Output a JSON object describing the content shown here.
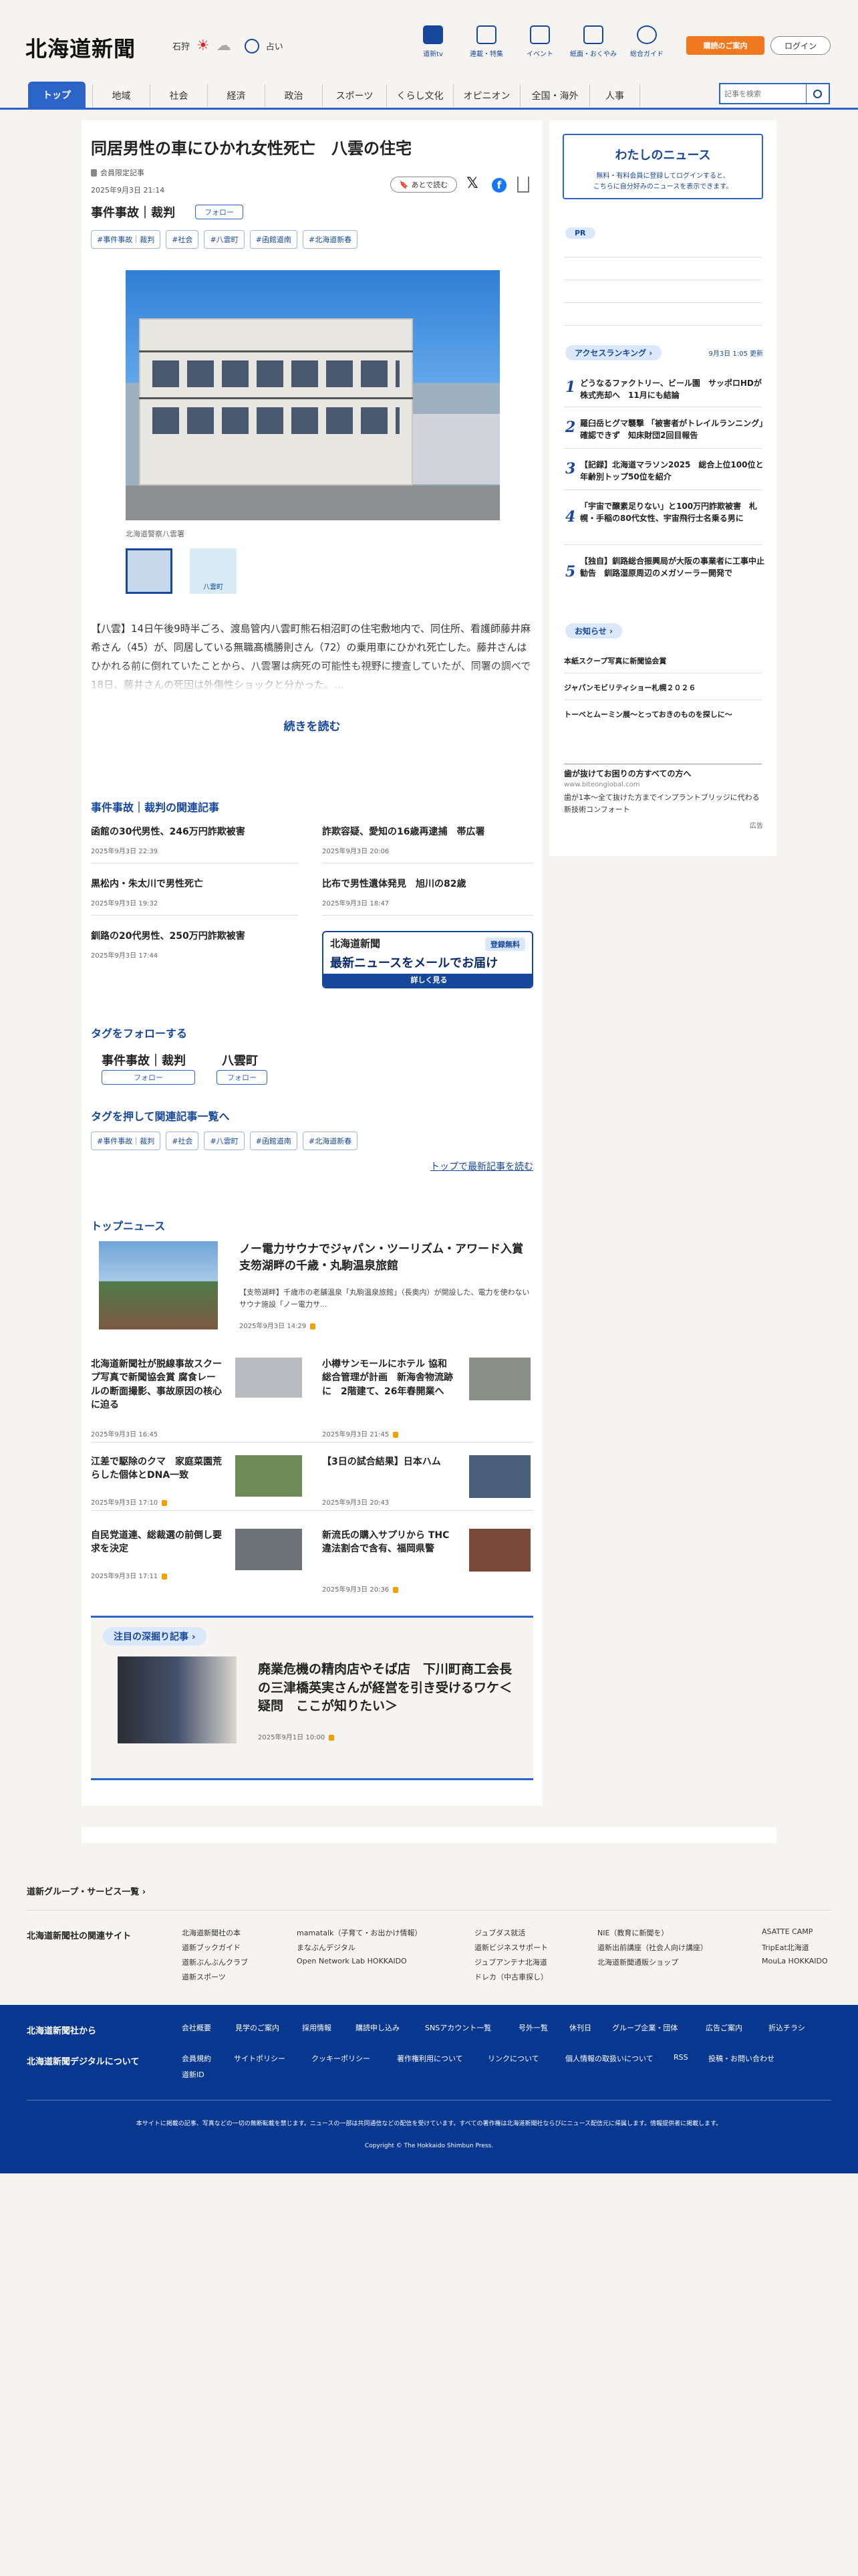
{
  "header": {
    "logo": "北海道新聞",
    "weather_region": "石狩",
    "fortune": "占い",
    "icons": [
      {
        "label": "道新tv",
        "icon": "tv-icon"
      },
      {
        "label": "連載・特集",
        "icon": "flag-icon"
      },
      {
        "label": "イベント",
        "icon": "calendar-icon"
      },
      {
        "label": "紙面・おくやみ",
        "icon": "newspaper-icon"
      },
      {
        "label": "総合ガイド",
        "icon": "help-icon"
      }
    ],
    "subscribe": "購読のご案内",
    "login": "ログイン"
  },
  "nav": {
    "items": [
      "トップ",
      "地域",
      "社会",
      "経済",
      "政治",
      "スポーツ",
      "くらし文化",
      "オピニオン",
      "全国・海外",
      "人事"
    ],
    "search_placeholder": "記事を検索"
  },
  "article": {
    "title": "同居男性の車にひかれ女性死亡　八雲の住宅",
    "badge": "会員限定記事",
    "date": "2025年9月3日 21:14",
    "save": "あとで読む",
    "category": "事件事故｜裁判",
    "follow": "フォロー",
    "tags": [
      "#事件事故｜裁判",
      "#社会",
      "#八雲町",
      "#函館道南",
      "#北海道新春"
    ],
    "caption": "北海道警察八雲署",
    "thumb2_label": "八雲町",
    "body": "【八雲】14日午後9時半ごろ、渡島管内八雲町熊石相沼町の住宅敷地内で、同住所、看護師藤井麻希さん（45）が、同居している無職髙橋勝則さん（72）の乗用車にひかれ死亡した。藤井さんはひかれる前に倒れていたことから、八雲署は病死の可能性も視野に捜査していたが、同署の調べで18日、藤井さんの死因は外傷性ショックと分かった。...",
    "read_more": "続きを読む"
  },
  "related": {
    "heading": "事件事故｜裁判の関連記事",
    "items": [
      {
        "title": "函館の30代男性、246万円詐欺被害",
        "date": "2025年9月3日 22:39"
      },
      {
        "title": "詐欺容疑、愛知の16歳再逮捕　帯広署",
        "date": "2025年9月3日 20:06"
      },
      {
        "title": "黒松内・朱太川で男性死亡",
        "date": "2025年9月3日 19:32"
      },
      {
        "title": "比布で男性遺体発見　旭川の82歳",
        "date": "2025年9月3日 18:47"
      },
      {
        "title": "釧路の20代男性、250万円詐欺被害",
        "date": "2025年9月3日 17:44"
      }
    ],
    "promo": {
      "logo": "北海道新聞",
      "tag": "登録無料",
      "main": "最新ニュースをメールでお届け",
      "cta": "詳しく見る"
    }
  },
  "follow_tags": {
    "heading": "タグをフォローする",
    "items": [
      "事件事故｜裁判",
      "八雲町"
    ],
    "follow": "フォロー"
  },
  "tag_list": {
    "heading": "タグを押して関連記事一覧へ",
    "latest_link": "トップで最新記事を読む"
  },
  "top_news": {
    "heading": "トップニュース",
    "lead": {
      "title": "ノー電力サウナでジャパン・ツーリズム・アワード入賞　支笏湖畔の千歳・丸駒温泉旅館",
      "summary": "【支笏湖畔】千歳市の老舗温泉「丸駒温泉旅館」（長奥内）が開設した、電力を使わないサウナ施設「ノー電力サ...",
      "date": "2025年9月3日 14:29"
    },
    "items": [
      {
        "title": "北海道新聞社が脱線事故スクープ写真で新聞協会賞 腐食レールの断面撮影、事故原因の核心に迫る",
        "date": "2025年9月3日 16:45"
      },
      {
        "title": "小樽サンモールにホテル 協和総合管理が計画　新海舎物流跡に　2階建て、26年春開業へ",
        "date": "2025年9月3日 21:45"
      },
      {
        "title": "江差で駆除のクマ　家庭菜園荒らした個体とDNA一致",
        "date": "2025年9月3日 17:10"
      },
      {
        "title": "【3日の試合結果】日本ハム",
        "date": "2025年9月3日 20:43"
      },
      {
        "title": "自民党道連、総裁選の前倒し要求を決定",
        "date": "2025年9月3日 17:11"
      },
      {
        "title": "新流氏の購入サプリから THC　違法割合で含有、福岡県警",
        "date": "2025年9月3日 20:36"
      }
    ]
  },
  "featured": {
    "heading": "注目の深掘り記事",
    "title": "廃業危機の精肉店やそば店　下川町商工会長の三津橋英実さんが経営を引き受けるワケ＜疑問　ここが知りたい＞",
    "date": "2025年9月1日 10:00"
  },
  "sidebar": {
    "mynews_title": "わたしのニュース",
    "mynews_desc1": "無料・有料会員に登録してログインすると、",
    "mynews_desc2": "こちらに自分好みのニュースを表示できます。",
    "pr": "PR",
    "ranking_title": "アクセスランキング",
    "ranking_updated": "9月3日 1:05 更新",
    "ranking": [
      {
        "num": "1",
        "title": "どうなるファクトリー、ビール園　サッポロHDが株式売却へ　11月にも結論"
      },
      {
        "num": "2",
        "title": "羅臼岳ヒグマ襲撃 「被害者がトレイルランニング」確認できず　知床財団2回目報告"
      },
      {
        "num": "3",
        "title": "【記録】北海道マラソン2025　総合上位100位と年齢別トップ50位を紹介"
      },
      {
        "num": "4",
        "title": "「宇宙で醸素足りない」と100万円詐欺被害　札幌・手稲の80代女性、宇宙飛行士名乗る男に"
      },
      {
        "num": "5",
        "title": "【独自】釧路総合振興局が大阪の事業者に工事中止勧告　釧路湿原周辺のメガソーラー開発で"
      }
    ],
    "notice_title": "お知らせ",
    "notices": [
      "本紙スクープ写真に新聞協会賞",
      "ジャパンモビリティショー札幌２０２６",
      "トーベとムーミン展〜とっておきのものを探しに〜"
    ],
    "ad_title": "歯が抜けてお困りの方すべての方へ",
    "ad_domain": "www.biteonglobal.com",
    "ad_desc": "歯が1本〜全て抜けた方までインプラントブリッジに代わる新技術コンフォート",
    "ad_label": "広告"
  },
  "footer": {
    "group_link": "道新グループ・サービス一覧",
    "related_sites": "北海道新聞社の関連サイト",
    "sites": [
      [
        "北海道新聞社の本",
        "道新ブックガイド",
        "道新ぶんぶんクラブ",
        "道新スポーツ"
      ],
      [
        "mamatalk（子育て・お出かけ情報）",
        "まなぶんデジタル",
        "Open Network Lab HOKKAIDO"
      ],
      [
        "ジュブダス就活",
        "道新ビジネスサポート",
        "ジュブアンテナ北海道",
        "ドレカ（中古車探し）"
      ],
      [
        "NIE（教育に新聞を）",
        "道新出前講座（社会人向け講座）",
        "北海道新聞通販ショップ"
      ],
      [
        "ASATTE CAMP",
        "TripEat北海道",
        "MouLa HOKKAIDO"
      ]
    ],
    "about1": "北海道新聞社から",
    "about2": "北海道新聞デジタルについて",
    "links1": [
      "会社概要",
      "見学のご案内",
      "採用情報",
      "購読申し込み",
      "SNSアカウント一覧",
      "号外一覧",
      "休刊日",
      "グループ企業・団体",
      "広告ご案内",
      "折込チラシ"
    ],
    "links2": [
      "会員規約",
      "サイトポリシー",
      "クッキーポリシー",
      "著作権利用について",
      "リンクについて",
      "個人情報の取扱いについて",
      "RSS",
      "投稿・お問い合わせ",
      "道新ID"
    ],
    "notice": "本サイトに掲載の記事、写真などの一切の無断転載を禁じます。ニュースの一部は共同通信などの配信を受けています。すべての著作権は北海道新聞社ならびにニュース配信元に帰属します。情報提供者に掲載します。",
    "copyright": "Copyright © The Hokkaido Shimbun Press."
  },
  "colors": {
    "brand_blue": "#16479a",
    "nav_blue": "#2c64c8",
    "footer_blue": "#08378f",
    "orange": "#f07820"
  }
}
